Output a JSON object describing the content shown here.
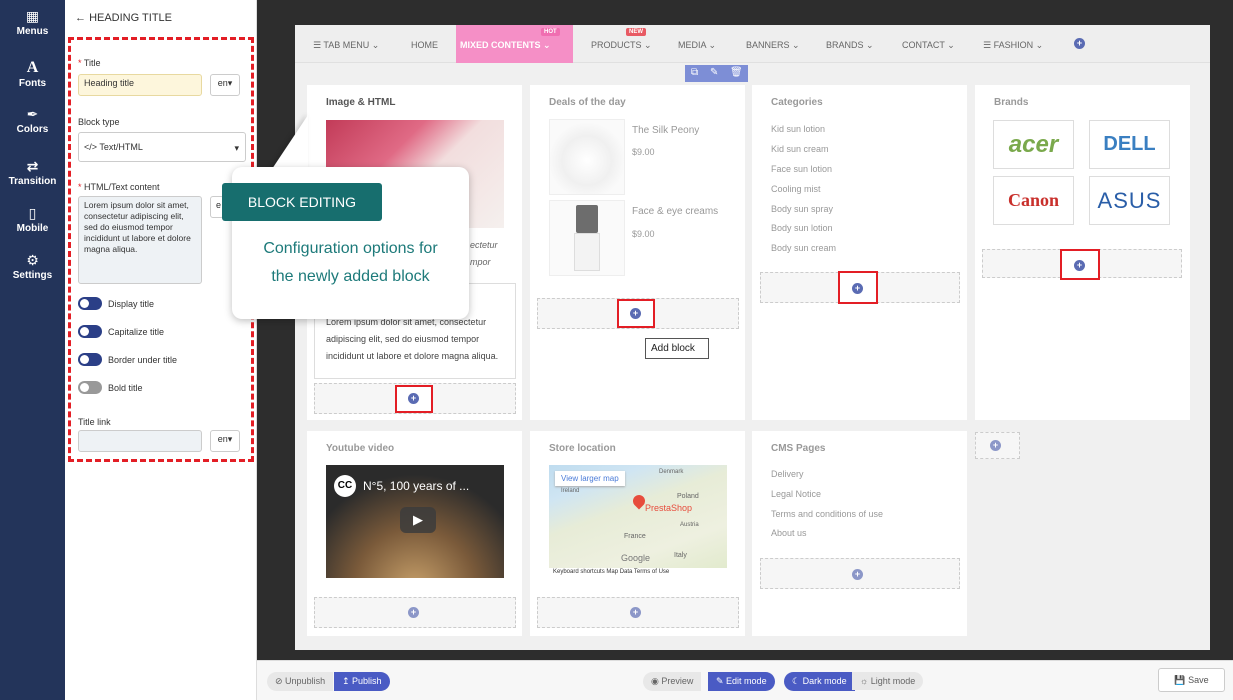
{
  "nav": {
    "items": [
      {
        "label": "Menus",
        "icon": "grid-icon"
      },
      {
        "label": "Fonts",
        "icon": "font-icon"
      },
      {
        "label": "Colors",
        "icon": "brush-icon"
      },
      {
        "label": "Transition",
        "icon": "shuffle-icon"
      },
      {
        "label": "Mobile",
        "icon": "mobile-icon"
      },
      {
        "label": "Settings",
        "icon": "gear-icon"
      }
    ]
  },
  "config": {
    "header": "HEADING TITLE",
    "title_label": "Title",
    "title_value": "Heading title",
    "lang": "en",
    "block_type_label": "Block type",
    "block_type_value": "</> Text/HTML",
    "html_label": "HTML/Text content",
    "html_value": "Lorem ipsum dolor sit amet, consectetur adipiscing elit, sed do eiusmod tempor incididunt ut labore et dolore magna aliqua.",
    "toggles": [
      "Display title",
      "Capitalize title",
      "Border under title",
      "Bold title"
    ],
    "title_link_label": "Title link",
    "title_link_lang": "en"
  },
  "callout": {
    "tag": "BLOCK EDITING",
    "line1": "Configuration options for",
    "line2": "the newly added block"
  },
  "menubar": {
    "items": [
      "TAB MENU",
      "HOME",
      "MIXED CONTENTS",
      "PRODUCTS",
      "MEDIA",
      "BANNERS",
      "BRANDS",
      "CONTACT",
      "FASHION"
    ],
    "badge_hot": "HOT",
    "badge_new": "NEW"
  },
  "columns": {
    "image_html": {
      "title": "Image & HTML",
      "snippet1": "ectetur",
      "snippet2": "mpor",
      "body": "Lorem ipsum dolor sit amet, consectetur adipiscing elit, sed do eiusmod tempor incididunt ut labore et dolore magna aliqua."
    },
    "deals": {
      "title": "Deals of the day",
      "products": [
        {
          "name": "The Silk Peony",
          "price": "$9.00"
        },
        {
          "name": "Face & eye creams",
          "price": "$9.00"
        }
      ],
      "tooltip": "Add block"
    },
    "categories": {
      "title": "Categories",
      "items": [
        "Kid sun lotion",
        "Kid sun cream",
        "Face sun lotion",
        "Cooling mist",
        "Body sun spray",
        "Body sun lotion",
        "Body sun cream"
      ]
    },
    "brands": {
      "title": "Brands",
      "logos": [
        "acer",
        "DELL",
        "Canon",
        "ASUS"
      ]
    },
    "youtube": {
      "title": "Youtube video",
      "video_title": "N°5, 100 years of ..."
    },
    "store": {
      "title": "Store location",
      "map_button": "View larger map",
      "map_label": "PrestaShop",
      "countries": [
        "Ireland",
        "Poland",
        "France",
        "Austria",
        "Italy",
        "Denmark"
      ],
      "footer": "Keyboard shortcuts   Map Data   Terms of Use",
      "brand": "Google"
    },
    "cms": {
      "title": "CMS Pages",
      "items": [
        "Delivery",
        "Legal Notice",
        "Terms and conditions of use",
        "About us"
      ]
    }
  },
  "bottombar": {
    "unpublish": "Unpublish",
    "publish": "Publish",
    "preview": "Preview",
    "edit_mode": "Edit mode",
    "dark_mode": "Dark mode",
    "light_mode": "Light mode",
    "save": "Save"
  },
  "colors": {
    "nav_bg": "#23345a",
    "accent_red": "#e31e25",
    "callout_teal": "#176e6e",
    "hot_pink": "#f58fc6",
    "publish_blue": "#4a5bc4"
  }
}
